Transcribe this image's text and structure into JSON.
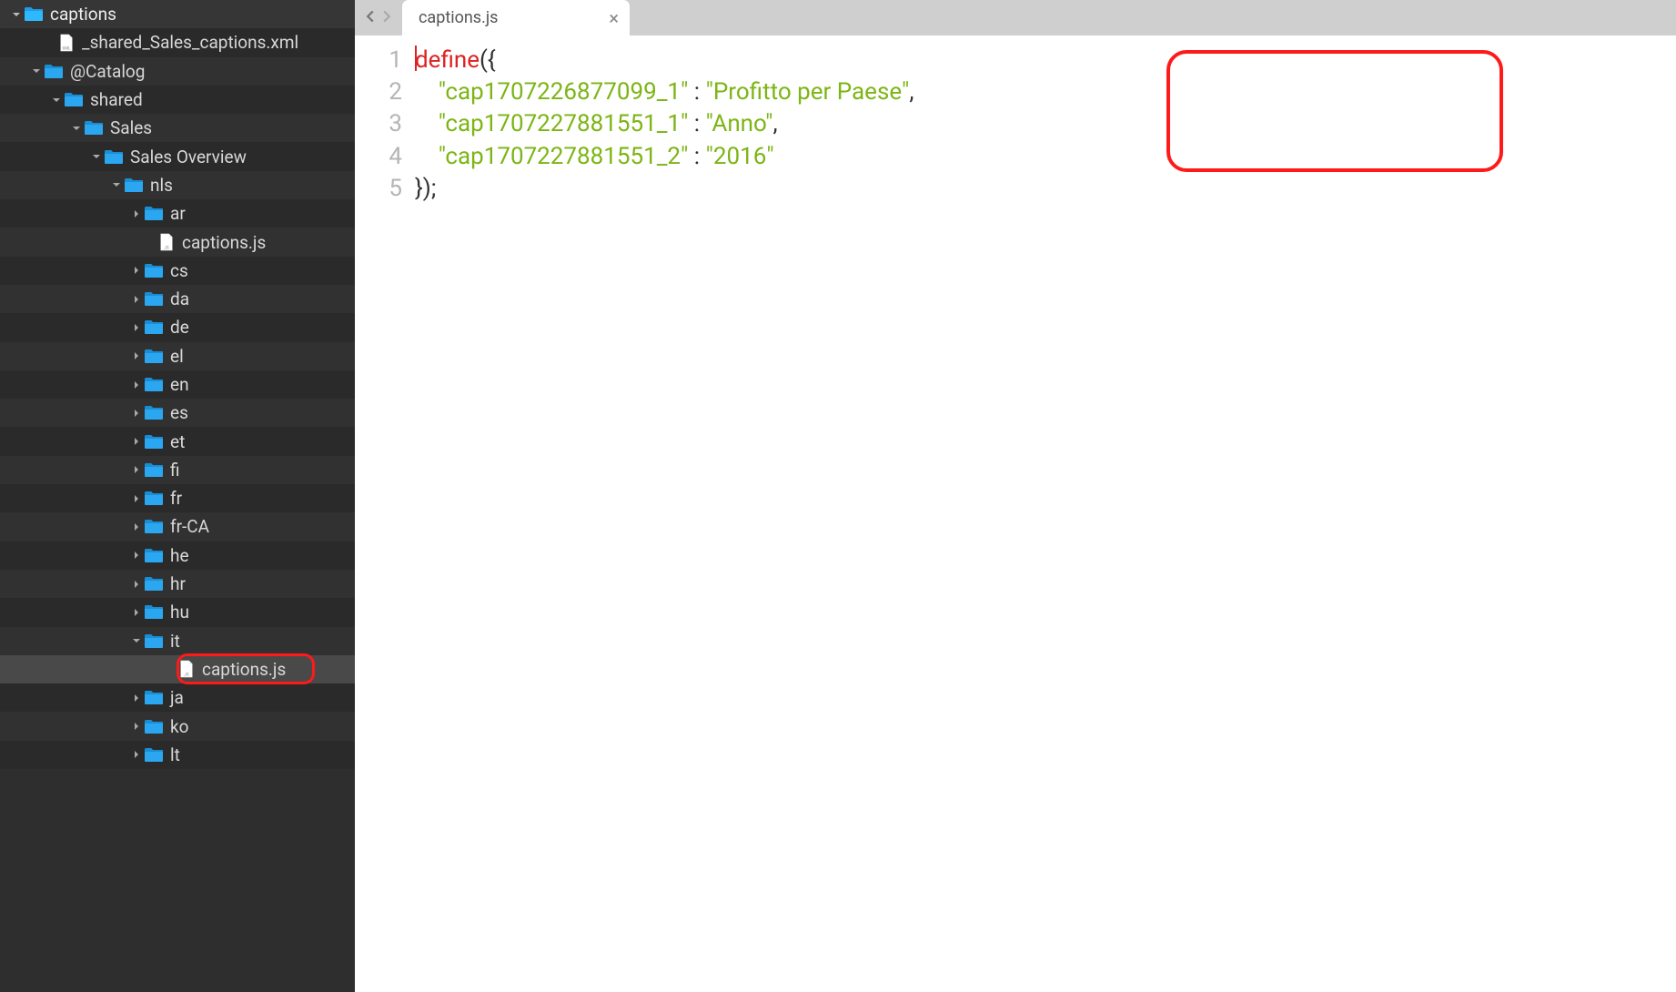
{
  "sidebar": {
    "items": [
      {
        "indent": 0,
        "chev": "down",
        "icon": "folder",
        "label": "captions"
      },
      {
        "indent": 1,
        "chev": "none",
        "icon": "file-xml",
        "label": "_shared_Sales_captions.xml"
      },
      {
        "indent": 1,
        "chev": "down",
        "icon": "folder",
        "label": "@Catalog"
      },
      {
        "indent": 2,
        "chev": "down",
        "icon": "folder",
        "label": "shared"
      },
      {
        "indent": 3,
        "chev": "down",
        "icon": "folder",
        "label": "Sales"
      },
      {
        "indent": 4,
        "chev": "down",
        "icon": "folder",
        "label": "Sales Overview"
      },
      {
        "indent": 5,
        "chev": "down",
        "icon": "folder",
        "label": "nls"
      },
      {
        "indent": 6,
        "chev": "right",
        "icon": "folder",
        "label": "ar"
      },
      {
        "indent": 6,
        "chev": "none",
        "icon": "file-js",
        "label": "captions.js"
      },
      {
        "indent": 6,
        "chev": "right",
        "icon": "folder",
        "label": "cs"
      },
      {
        "indent": 6,
        "chev": "right",
        "icon": "folder",
        "label": "da"
      },
      {
        "indent": 6,
        "chev": "right",
        "icon": "folder",
        "label": "de"
      },
      {
        "indent": 6,
        "chev": "right",
        "icon": "folder",
        "label": "el"
      },
      {
        "indent": 6,
        "chev": "right",
        "icon": "folder",
        "label": "en"
      },
      {
        "indent": 6,
        "chev": "right",
        "icon": "folder",
        "label": "es"
      },
      {
        "indent": 6,
        "chev": "right",
        "icon": "folder",
        "label": "et"
      },
      {
        "indent": 6,
        "chev": "right",
        "icon": "folder",
        "label": "fi"
      },
      {
        "indent": 6,
        "chev": "right",
        "icon": "folder",
        "label": "fr"
      },
      {
        "indent": 6,
        "chev": "right",
        "icon": "folder",
        "label": "fr-CA"
      },
      {
        "indent": 6,
        "chev": "right",
        "icon": "folder",
        "label": "he"
      },
      {
        "indent": 6,
        "chev": "right",
        "icon": "folder",
        "label": "hr"
      },
      {
        "indent": 6,
        "chev": "right",
        "icon": "folder",
        "label": "hu"
      },
      {
        "indent": 6,
        "chev": "down",
        "icon": "folder",
        "label": "it"
      },
      {
        "indent": 7,
        "chev": "none",
        "icon": "file-js",
        "label": "captions.js",
        "selected": true,
        "highlight": true
      },
      {
        "indent": 6,
        "chev": "right",
        "icon": "folder",
        "label": "ja"
      },
      {
        "indent": 6,
        "chev": "right",
        "icon": "folder",
        "label": "ko"
      },
      {
        "indent": 6,
        "chev": "right",
        "icon": "folder",
        "label": "lt"
      }
    ]
  },
  "tabbar": {
    "active_tab": "captions.js"
  },
  "code": {
    "lines": [
      "1",
      "2",
      "3",
      "4",
      "5"
    ],
    "fn": "define",
    "open_brace_paren": "({",
    "entries": [
      {
        "key": "\"cap1707226877099_1\"",
        "sep": " : ",
        "val": "\"Profitto per Paese\"",
        "comma": ","
      },
      {
        "key": "\"cap1707227881551_1\"",
        "sep": " : ",
        "val": "\"Anno\"",
        "comma": ","
      },
      {
        "key": "\"cap1707227881551_2\"",
        "sep": " : ",
        "val": "\"2016\"",
        "comma": ""
      }
    ],
    "close": "});"
  }
}
